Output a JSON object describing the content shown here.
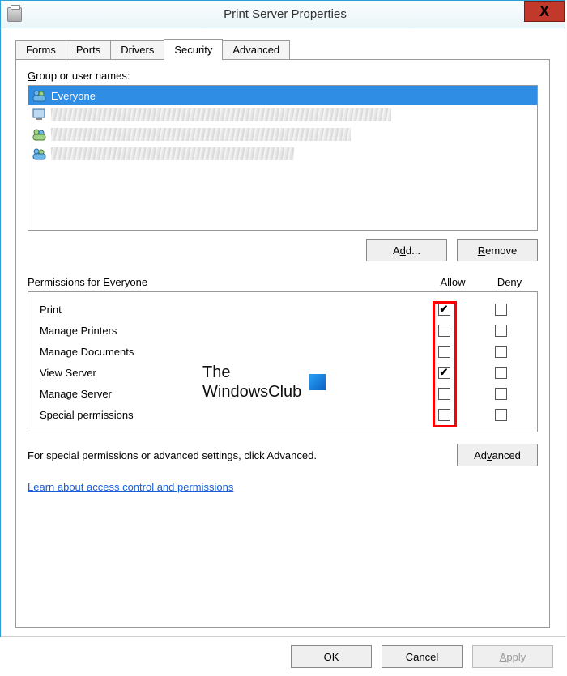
{
  "window": {
    "title": "Print Server Properties",
    "close": "X"
  },
  "tabs": {
    "forms": "Forms",
    "ports": "Ports",
    "drivers": "Drivers",
    "security": "Security",
    "advanced": "Advanced"
  },
  "security": {
    "group_label": "Group or user names:",
    "add_btn": "Add...",
    "remove_btn": "Remove",
    "users": {
      "selected": "Everyone"
    },
    "permissions_for": "Permissions for Everyone",
    "col_allow": "Allow",
    "col_deny": "Deny",
    "rows": [
      {
        "name": "Print",
        "allow": true,
        "deny": false
      },
      {
        "name": "Manage Printers",
        "allow": false,
        "deny": false
      },
      {
        "name": "Manage Documents",
        "allow": false,
        "deny": false
      },
      {
        "name": "View Server",
        "allow": true,
        "deny": false
      },
      {
        "name": "Manage Server",
        "allow": false,
        "deny": false
      },
      {
        "name": "Special permissions",
        "allow": false,
        "deny": false
      }
    ],
    "footnote": "For special permissions or advanced settings, click Advanced.",
    "advanced_btn": "Advanced",
    "help_link": "Learn about access control and permissions"
  },
  "buttons": {
    "ok": "OK",
    "cancel": "Cancel",
    "apply": "Apply"
  },
  "watermark": {
    "line1": "The",
    "line2": "WindowsClub"
  }
}
